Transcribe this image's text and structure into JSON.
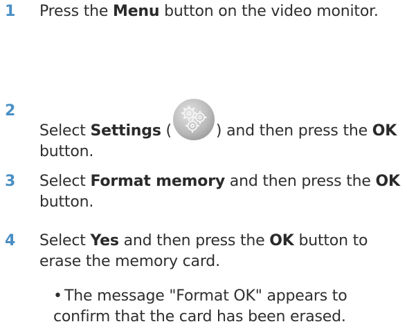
{
  "steps": [
    {
      "number": "1",
      "pre": "Press the ",
      "bold1": "Menu",
      "post": " button on the video monitor."
    },
    {
      "number": "2",
      "pre": "Select ",
      "bold1": "Settings",
      "paren_open": " (",
      "paren_close": ") and then press the ",
      "bold2": "OK",
      "post": " button.",
      "icon": "settings-gears-icon"
    },
    {
      "number": "3",
      "pre": "Select ",
      "bold1": "Format memory",
      "mid": " and then press the ",
      "bold2": "OK",
      "post": " button."
    },
    {
      "number": "4",
      "pre": "Select ",
      "bold1": "Yes",
      "mid": " and then press the ",
      "bold2": "OK",
      "post": " button to erase the memory card.",
      "bullet": "The message \"Format OK\" appears to confirm that the card has been erased."
    }
  ],
  "colors": {
    "step_number": "#4a8fc4",
    "text": "#2e2e2e"
  }
}
